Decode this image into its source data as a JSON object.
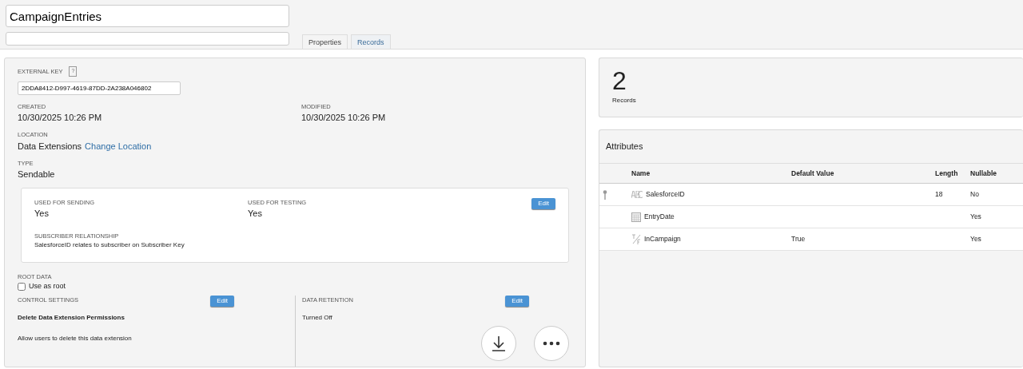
{
  "name_field": {
    "value": "CampaignEntries"
  },
  "tabs": [
    {
      "label": "Properties",
      "selected": true
    },
    {
      "label": "Records",
      "selected": false
    }
  ],
  "properties": {
    "external_key": {
      "label": "EXTERNAL KEY",
      "help": "?",
      "value": "2DDA8412-D997-4619-87DD-2A238A046802"
    },
    "created": {
      "label": "CREATED",
      "value": "10/30/2025 10:26 PM"
    },
    "modified": {
      "label": "MODIFIED",
      "value": "10/30/2025 10:26 PM"
    },
    "location": {
      "label": "LOCATION",
      "value": "Data Extensions",
      "link": "Change Location"
    },
    "type": {
      "label": "TYPE",
      "value": "Sendable"
    },
    "sendable_card": {
      "used_for_sending": {
        "label": "USED FOR SENDING",
        "value": "Yes"
      },
      "used_for_testing": {
        "label": "USED FOR TESTING",
        "value": "Yes"
      },
      "edit_button": "Edit",
      "subscriber_relationship": {
        "label": "SUBSCRIBER RELATIONSHIP",
        "value": "SalesforceID relates to subscriber on Subscriber Key"
      }
    },
    "root_data": {
      "label": "ROOT DATA",
      "checkbox_label": "Use as root",
      "checked": false
    },
    "control_settings": {
      "label": "CONTROL SETTINGS",
      "edit_button": "Edit",
      "title": "Delete Data Extension Permissions",
      "description": "Allow users to delete this data extension"
    },
    "data_retention": {
      "label": "DATA RETENTION",
      "edit_button": "Edit",
      "value": "Turned Off"
    }
  },
  "record_count": {
    "value": "2",
    "label": "Records"
  },
  "attributes": {
    "title": "Attributes",
    "columns": [
      "Name",
      "Default Value",
      "Length",
      "Nullable"
    ],
    "rows": [
      {
        "primary_key": true,
        "kind": "text",
        "name": "SalesforceID",
        "default_value": "",
        "length": "18",
        "nullable": "No"
      },
      {
        "primary_key": false,
        "kind": "date",
        "name": "EntryDate",
        "default_value": "",
        "length": "",
        "nullable": "Yes"
      },
      {
        "primary_key": false,
        "kind": "boolean",
        "name": "InCampaign",
        "default_value": "True",
        "length": "",
        "nullable": "Yes"
      }
    ]
  }
}
